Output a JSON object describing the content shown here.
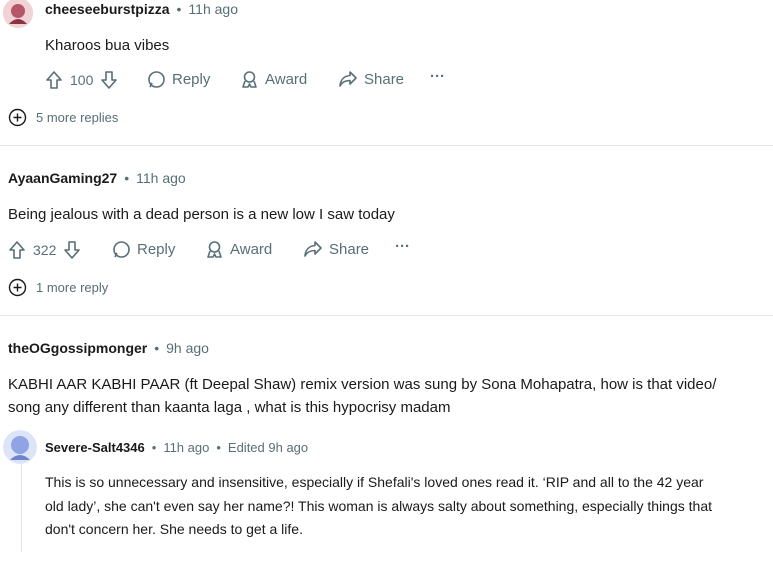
{
  "comments": [
    {
      "user": "cheeseeburstpizza",
      "time": "11h ago",
      "text": "Kharoos bua vibes",
      "votes": "100",
      "actions": {
        "reply": "Reply",
        "award": "Award",
        "share": "Share",
        "more": "···"
      },
      "more_replies": "5 more replies"
    },
    {
      "user": "AyaanGaming27",
      "time": "11h ago",
      "text": "Being jealous with a dead person is a new low I saw today",
      "votes": "322",
      "actions": {
        "reply": "Reply",
        "award": "Award",
        "share": "Share",
        "more": "···"
      },
      "more_replies": "1 more reply"
    },
    {
      "user": "theOGgossipmonger",
      "time": "9h ago",
      "text_line1": "KABHI AAR KABHI PAAR (ft Deepal Shaw) remix version was sung by Sona Mohapatra, how is that video/",
      "text_line2": "song any different than kaanta laga , what is this hypocrisy madam"
    }
  ],
  "reply": {
    "user": "Severe-Salt4346",
    "time": "11h ago",
    "edited": "Edited 9h ago",
    "line1": "This is so unnecessary and insensitive, especially if Shefali's loved ones read it. ‘RIP and all to the 42 year",
    "line2": "old lady’, she can't even say her name?! This woman is always salty about something, especially things that",
    "line3": "don't concern her. She needs to get a life."
  },
  "separator": "•",
  "colors": {
    "text": "#1a1a1b",
    "meta": "#576f76",
    "avatar_pink": "#b5566a",
    "avatar_blue": "#8fa3e6"
  }
}
